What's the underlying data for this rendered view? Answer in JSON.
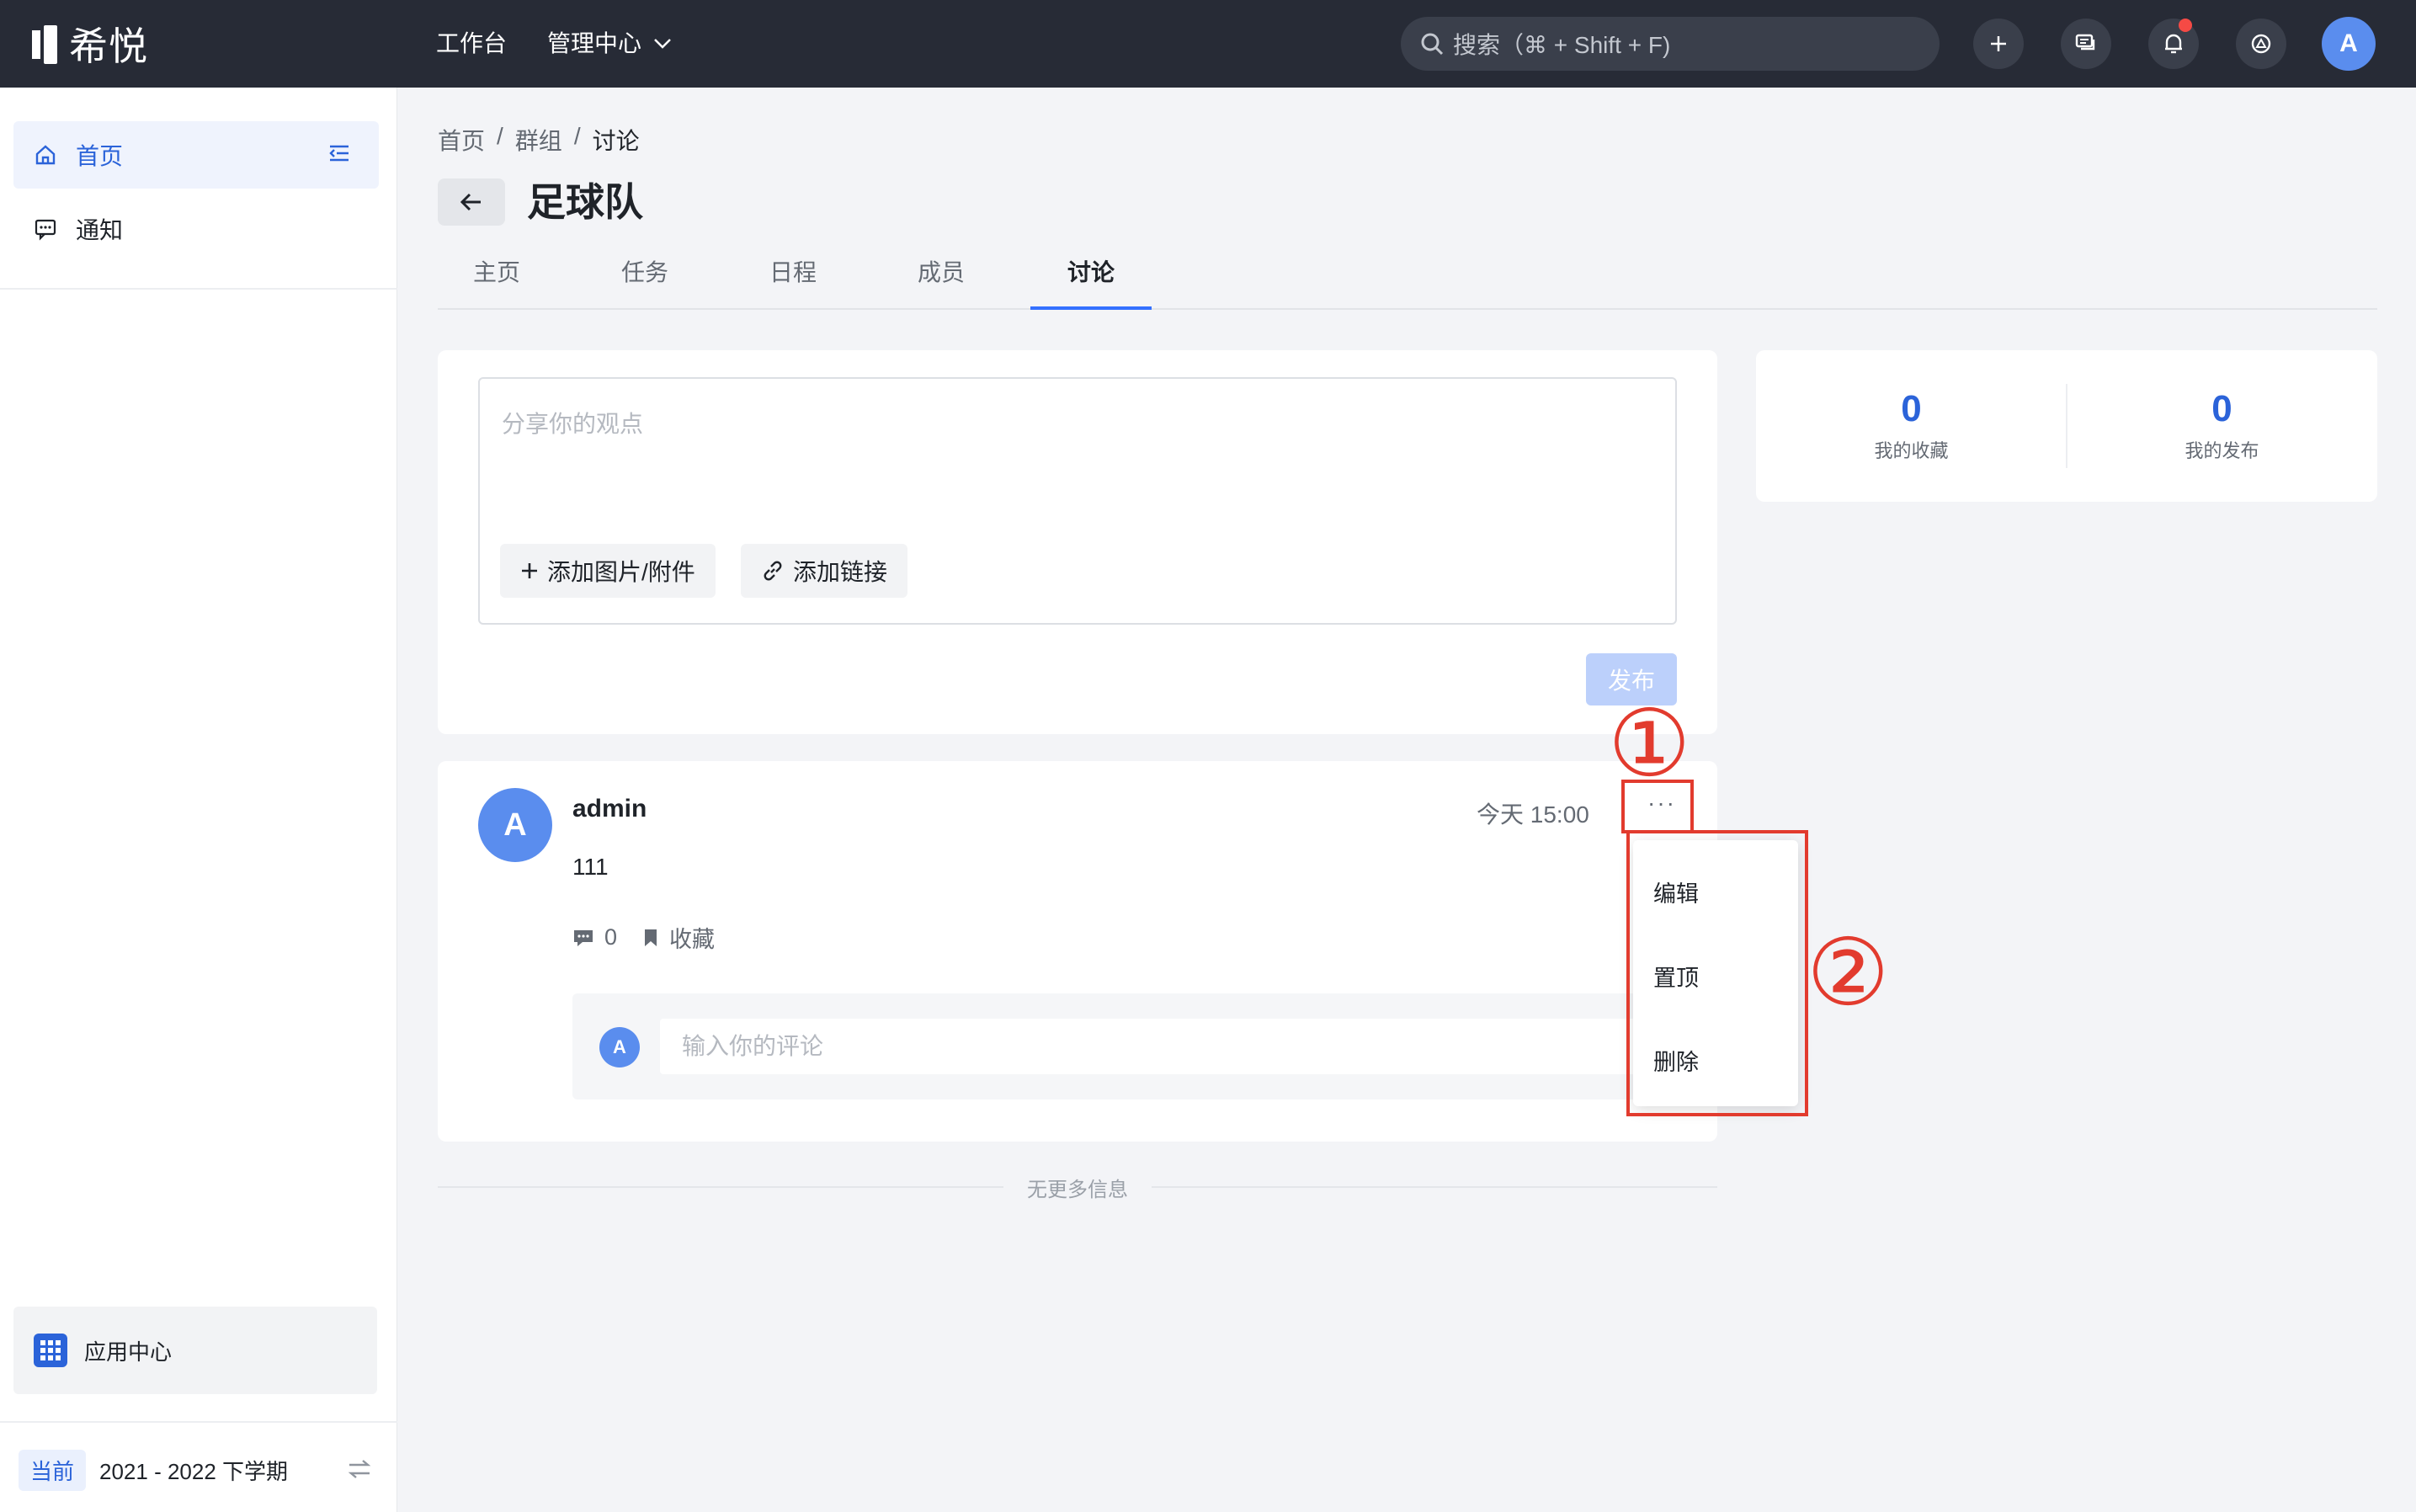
{
  "topbar": {
    "logo_text": "希悦",
    "nav": [
      {
        "label": "工作台"
      },
      {
        "label": "管理中心"
      }
    ],
    "search_placeholder": "搜索（⌘ + Shift + F)",
    "avatar_initial": "A"
  },
  "sidebar": {
    "items": [
      {
        "label": "首页"
      },
      {
        "label": "通知"
      }
    ],
    "app_center_label": "应用中心",
    "term": {
      "badge": "当前",
      "value": "2021 - 2022 下学期"
    }
  },
  "breadcrumb": [
    "首页",
    "/",
    "群组",
    "/",
    "讨论"
  ],
  "page": {
    "title": "足球队"
  },
  "tabs": [
    {
      "label": "主页"
    },
    {
      "label": "任务"
    },
    {
      "label": "日程"
    },
    {
      "label": "成员"
    },
    {
      "label": "讨论"
    }
  ],
  "composer": {
    "placeholder": "分享你的观点",
    "add_attachment": "添加图片/附件",
    "add_link": "添加链接",
    "publish": "发布"
  },
  "stats": [
    {
      "value": "0",
      "label": "我的收藏"
    },
    {
      "value": "0",
      "label": "我的发布"
    }
  ],
  "post": {
    "avatar_initial": "A",
    "author": "admin",
    "time": "今天 15:00",
    "more": "···",
    "body": "111",
    "comment_count": "0",
    "favorite_label": "收藏",
    "comment_avatar": "A",
    "comment_placeholder": "输入你的评论"
  },
  "menu": {
    "items": [
      {
        "label": "编辑"
      },
      {
        "label": "置顶"
      },
      {
        "label": "删除"
      }
    ]
  },
  "no_more": "无更多信息",
  "annotations": {
    "one": "①",
    "two": "②"
  },
  "colors": {
    "accent": "#3370ff",
    "topbar": "#272b36",
    "annotation": "#e23b2e",
    "notification_dot": "#f54a45"
  }
}
